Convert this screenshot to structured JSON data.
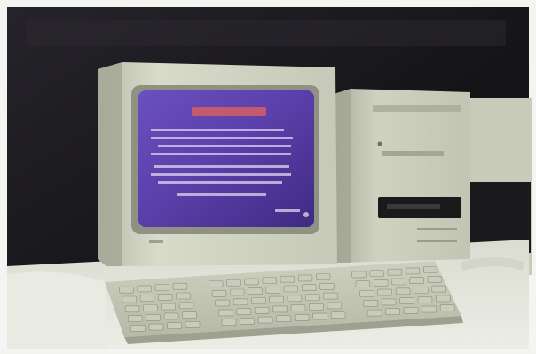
{
  "photo": {
    "subject": "desktop-computer",
    "colors": {
      "backdrop": "#1b1a1c",
      "case_beige": "#d6d8c6",
      "case_shadow": "#9fa291",
      "screen_purple": "#5b3fa6",
      "screen_header": "#c0556a",
      "screen_text": "#ddd6ee",
      "keyboard_key": "#c9ccbb",
      "desk": "#e4e6dc",
      "border": "#f4f4f2"
    }
  }
}
